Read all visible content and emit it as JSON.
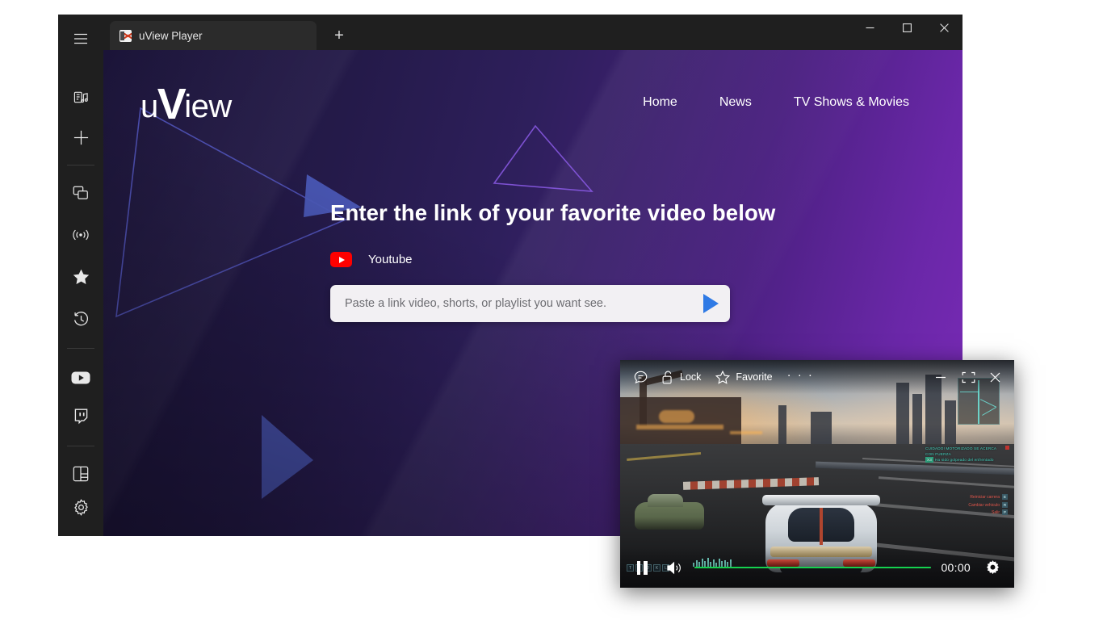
{
  "window": {
    "tab": {
      "title": "uView Player",
      "favicon": "uview-favicon"
    },
    "new_tab_label": "+",
    "controls": {
      "minimize": "–",
      "maximize": "□",
      "close": "✕"
    }
  },
  "sidebar": {
    "items": [
      {
        "name": "hamburger-menu",
        "icon": "hamburger-icon"
      },
      {
        "name": "media-library",
        "icon": "media-note-icon"
      },
      {
        "name": "add",
        "icon": "plus-icon"
      },
      {
        "name": "split-window",
        "icon": "copy-window-icon"
      },
      {
        "name": "live",
        "icon": "broadcast-icon"
      },
      {
        "name": "favorites",
        "icon": "star-icon"
      },
      {
        "name": "history",
        "icon": "history-clock-icon"
      },
      {
        "name": "youtube",
        "icon": "youtube-icon"
      },
      {
        "name": "twitch",
        "icon": "twitch-icon"
      },
      {
        "name": "layout",
        "icon": "layout-panel-icon"
      },
      {
        "name": "settings",
        "icon": "gear-icon"
      }
    ]
  },
  "page": {
    "brand": {
      "prefix": "u",
      "accent": "V",
      "suffix": "iew"
    },
    "nav": [
      {
        "label": "Home"
      },
      {
        "label": "News"
      },
      {
        "label": "TV Shows & Movies"
      }
    ],
    "heading": "Enter the link of your favorite video below",
    "source": {
      "label": "Youtube",
      "icon": "youtube-icon",
      "color": "#ff0000"
    },
    "url_input": {
      "value": "",
      "placeholder": "Paste a link video, shorts, or playlist you want see."
    },
    "go_button": {
      "label": "play-arrow",
      "color": "#2f7ae5"
    },
    "colors": {
      "bg_dark": "#1b1438",
      "bg_mid": "#2e1f5c",
      "bg_purple": "#7b2bb8",
      "triangle_blue": "#4a57b5",
      "triangle_violet": "#7a4fd6"
    }
  },
  "pip_player": {
    "top_bar": {
      "subtitles": {
        "label": "",
        "icon": "caption-bubble-icon"
      },
      "lock": {
        "label": "Lock",
        "icon": "unlocked-padlock-icon"
      },
      "favorite": {
        "label": "Favorite",
        "icon": "star-outline-icon"
      },
      "more": {
        "label": "· · ·",
        "icon": "more-dots-icon"
      },
      "minimize": {
        "label": "—",
        "icon": "minimize-icon"
      },
      "fullscreen": {
        "label": "",
        "icon": "fullscreen-icon"
      },
      "close": {
        "label": "✕",
        "icon": "close-icon"
      }
    },
    "bottom_bar": {
      "pause": {
        "icon": "pause-icon"
      },
      "volume": {
        "icon": "speaker-volume-icon"
      },
      "progress_percent": 0,
      "progress_color": "#15d14f",
      "time": "00:00",
      "settings": {
        "icon": "gear-icon"
      }
    },
    "video": {
      "scene": "racing-game-gameplay",
      "hud_message_line1": "CUIDADO! MOTORIZADO SE ACERCA",
      "hud_message_line2": "CON FUERZA",
      "hud_message_pill": "X3",
      "hud_message_pill_text": "Ha sido golpeado del enfrentado",
      "hud_right": [
        {
          "label": "Reiniciar carrera",
          "key": "E"
        },
        {
          "label": "Cambiar vehiculo",
          "key": "R"
        },
        {
          "label": "Salir",
          "key": "P"
        }
      ]
    }
  }
}
